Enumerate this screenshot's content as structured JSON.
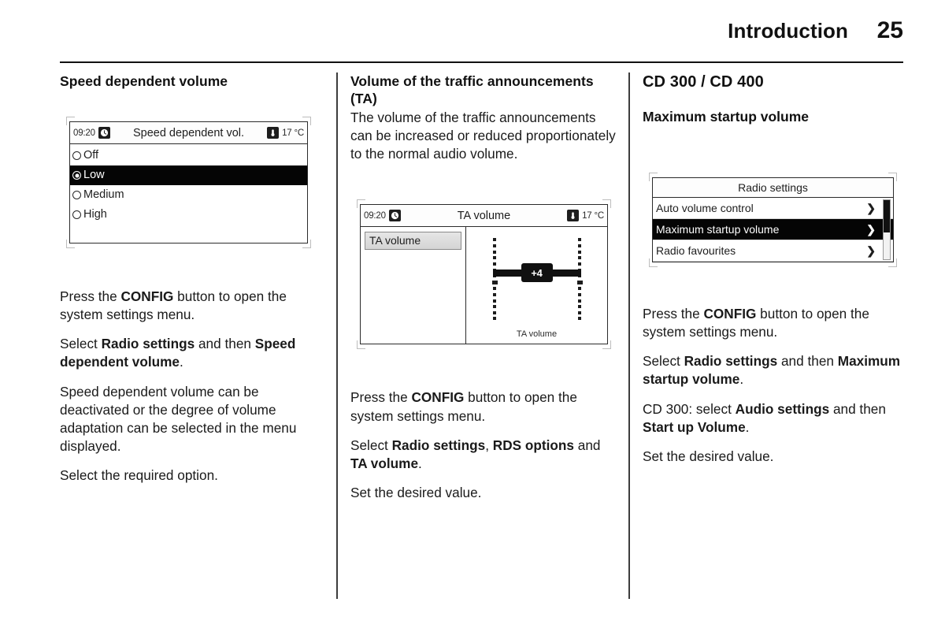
{
  "header": {
    "title": "Introduction",
    "page_number": "25"
  },
  "columns": {
    "col1": {
      "heading": "Speed dependent volume",
      "display": {
        "status": {
          "time": "09:20",
          "clock_icon": "clock-icon",
          "title": "Speed dependent vol.",
          "thermometer_icon": "thermometer-icon",
          "temperature": "17 °C"
        },
        "options": [
          {
            "label": "Off",
            "selected": false
          },
          {
            "label": "Low",
            "selected": true
          },
          {
            "label": "Medium",
            "selected": false
          },
          {
            "label": "High",
            "selected": false
          }
        ]
      },
      "paragraphs": [
        "Press the <b>CONFIG</b> button to open the system settings menu.",
        "Select <b>Radio settings</b> and then <b>Speed dependent volume</b>.",
        "Speed dependent volume can be deactivated or the degree of volume adaptation can be selected in the menu displayed.",
        "Select the required option."
      ]
    },
    "col2": {
      "heading": "Volume of the traffic announcements (TA)",
      "intro": "The volume of the traffic announcements can be increased or reduced proportionately to the normal audio volume.",
      "display": {
        "status": {
          "time": "09:20",
          "clock_icon": "clock-icon",
          "title": "TA volume",
          "thermometer_icon": "thermometer-icon",
          "temperature": "17 °C"
        },
        "list_item": "TA volume",
        "slider": {
          "value": "+4",
          "caption": "TA volume",
          "tick_count": 14
        }
      },
      "paragraphs": [
        "Press the <b>CONFIG</b> button to open the system settings menu.",
        "Select <b>Radio settings</b>, <b>RDS options</b> and <b>TA volume</b>.",
        "Set the desired value."
      ]
    },
    "col3": {
      "heading": "CD 300 / CD 400",
      "subheading": "Maximum startup volume",
      "display": {
        "menu_title": "Radio settings",
        "rows": [
          {
            "label": "Auto volume control",
            "chevron": "❯",
            "selected": false
          },
          {
            "label": "Maximum startup volume",
            "chevron": "❯",
            "selected": true
          },
          {
            "label": "Radio favourites",
            "chevron": "❯",
            "selected": false
          }
        ],
        "scrollbar": {
          "thumb_position": "top"
        }
      },
      "paragraphs": [
        "Press the <b>CONFIG</b> button to open the system settings menu.",
        "Select <b>Radio settings</b> and then <b>Maximum startup volume</b>.",
        "CD 300: select <b>Audio settings</b> and then <b>Start up Volume</b>.",
        "Set the desired value."
      ]
    }
  }
}
